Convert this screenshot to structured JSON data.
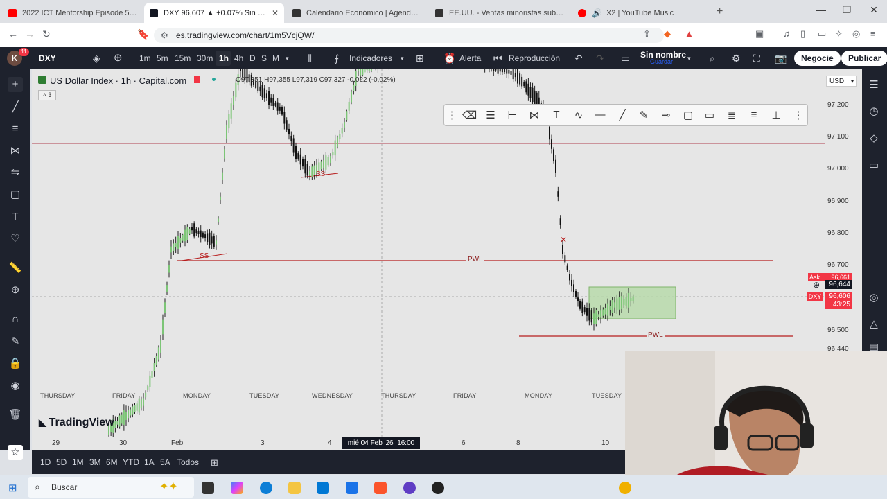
{
  "browser": {
    "tabs": [
      {
        "title": "2022 ICT Mentorship Episode 5 - You",
        "icon_color": "#ff0000",
        "active": false
      },
      {
        "title": "DXY 96,607 ▲ +0.07% Sin nomb",
        "icon_color": "#131722",
        "active": true
      },
      {
        "title": "Calendario Económico | Agenda Eco",
        "icon_color": "#333333",
        "active": false
      },
      {
        "title": "EE.UU. - Ventas minoristas subyacent",
        "icon_color": "#333333",
        "active": false
      },
      {
        "title": "X2 | YouTube Music",
        "icon_color": "#ff0000",
        "active": false
      }
    ],
    "url": "es.tradingview.com/chart/1m5VcjQW/"
  },
  "toolbar": {
    "symbol": "DXY",
    "badge_count": "11",
    "intervals": [
      "1m",
      "5m",
      "15m",
      "30m",
      "1h",
      "4h",
      "D",
      "S",
      "M"
    ],
    "active_interval": "1h",
    "indicators_label": "Indicadores",
    "alert_label": "Alerta",
    "replay_label": "Reproducción",
    "layout_name": "Sin nombre",
    "save_label": "Guardar",
    "trade_label": "Negocie",
    "publish_label": "Publicar"
  },
  "chart": {
    "legend_title": "US Dollar Index · 1h · Capital.com",
    "ohlc": "O97,351 H97,355 L97,319 C97,327 -0,022 (-0,02%)",
    "indicator_count": "3",
    "currency": "USD",
    "annotations": {
      "pwl1": "PWL",
      "pwl2": "PWL",
      "ss1": "SS",
      "ss2": "SS"
    },
    "price_ticks": [
      "97,200",
      "97,100",
      "97,000",
      "96,900",
      "96,800",
      "96,700",
      "96,500",
      "96,440"
    ],
    "price_labels": {
      "ask_label": "Ask",
      "ask": "96,661",
      "crosshair": "96,644",
      "symbol_tag": "DXY",
      "last": "96,606",
      "countdown": "43:25"
    },
    "day_labels": [
      "THURSDAY",
      "FRIDAY",
      "MONDAY",
      "TUESDAY",
      "WEDNESDAY",
      "THURSDAY",
      "FRIDAY",
      "MONDAY",
      "TUESDAY"
    ],
    "date_labels": [
      "29",
      "30",
      "Feb",
      "3",
      "4",
      "6",
      "8",
      "10"
    ],
    "crosshair_date": "mié 04 Feb '26",
    "crosshair_time": "16:00",
    "brand": "TradingView"
  },
  "bottom": {
    "ranges": [
      "1D",
      "5D",
      "1M",
      "3M",
      "6M",
      "YTD",
      "1A",
      "5A",
      "Todos"
    ]
  },
  "taskbar": {
    "search_placeholder": "Buscar"
  }
}
